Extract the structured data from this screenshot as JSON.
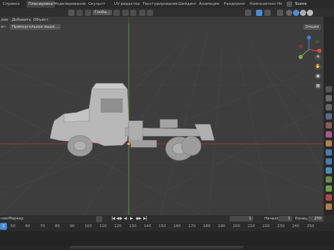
{
  "menu": {
    "help": "Справка",
    "tabs": [
      "Планировка",
      "Моделирование",
      "Скульпт",
      "UV-редактор",
      "Текстурирование",
      "Шейдинг",
      "Анимация",
      "Рендеринг",
      "Композитинг",
      "Но"
    ],
    "scene": "Scene"
  },
  "toolbar": {
    "transform_orientation": "Глоба...",
    "viewport_colors": {
      "active_shading": "#4a8bd6",
      "xray": "#5a5a5a"
    }
  },
  "header": {
    "view_left": "лие",
    "add": "Добавить",
    "object": "Объект",
    "select_mode_label": "ат:",
    "select_mode_value": "Прямоугольное выде...",
    "options": "Опции"
  },
  "gizmo": {
    "x": "X",
    "y": "Y",
    "z": "Z"
  },
  "timeline": {
    "view_label": "ние",
    "marker": "Маркер",
    "current_frame": "1",
    "start_label": "Начало",
    "start_value": "1",
    "end_label": "Конец",
    "end_value": "250",
    "ruler": [
      "50",
      "60",
      "70",
      "80",
      "90",
      "100",
      "110",
      "120",
      "130",
      "140",
      "150",
      "160",
      "170",
      "180",
      "190",
      "200",
      "210",
      "220",
      "230",
      "240",
      "250"
    ],
    "playhead_frame": "1",
    "colors": {
      "axis_red": "#9a3b3b",
      "axis_green": "#6a8a3a",
      "accent": "#4a8bd6"
    }
  },
  "side_icons": [
    "tool-icon",
    "render-icon",
    "output-icon",
    "view-layer-icon",
    "scene-icon",
    "world-icon",
    "object-icon",
    "modifier-icon",
    "particles-icon",
    "physics-icon",
    "constraints-icon",
    "data-icon",
    "material-icon",
    "texture-icon"
  ]
}
